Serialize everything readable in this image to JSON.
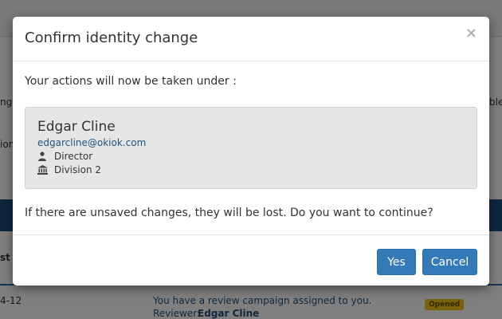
{
  "background": {
    "snippets": [
      {
        "text": "ng f"
      },
      {
        "text": "ion"
      },
      {
        "text": "ble"
      },
      {
        "text": "st"
      },
      {
        "text": "4-12"
      },
      {
        "text": "You have a review campaign assigned to you."
      },
      {
        "text": "Reviewer:"
      },
      {
        "text": "Edgar Cline"
      },
      {
        "text": "Opened"
      }
    ]
  },
  "modal": {
    "title": "Confirm identity change",
    "close_glyph": "×",
    "intro": "Your actions will now be taken under :",
    "user": {
      "name": "Edgar Cline",
      "email": "edgarcline@okiok.com",
      "role": "Director",
      "division": "Division 2",
      "role_icon": "user-icon",
      "division_icon": "bank-icon"
    },
    "warning": "If there are unsaved changes, they will be lost. Do you want to continue?",
    "buttons": {
      "yes": "Yes",
      "cancel": "Cancel"
    }
  },
  "colors": {
    "primary": "#337ab7",
    "link": "#23527c",
    "card_bg": "#e6e6e6",
    "badge": "#f0c419"
  }
}
